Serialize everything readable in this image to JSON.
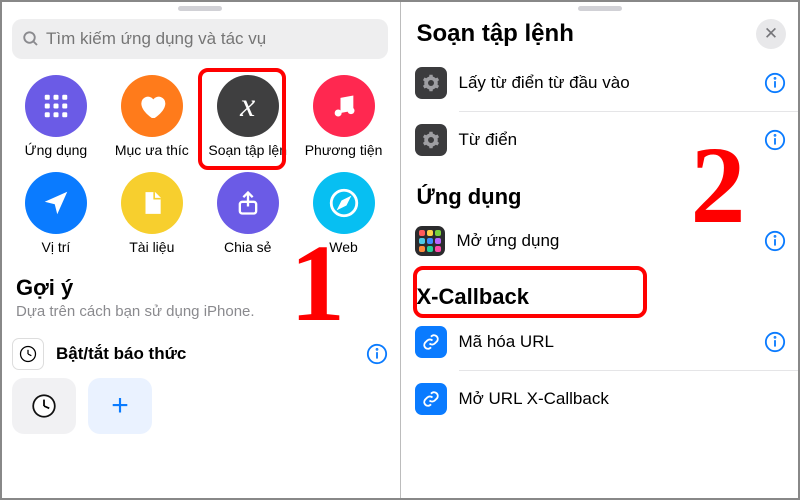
{
  "left": {
    "search_placeholder": "Tìm kiếm ứng dụng và tác vụ",
    "categories": [
      {
        "id": "apps",
        "label": "Ứng dụng",
        "bg": "#6b5be6",
        "icon": "grid"
      },
      {
        "id": "favorites",
        "label": "Mục ưa thíc",
        "bg": "#ff7b1b",
        "icon": "heart"
      },
      {
        "id": "scripting",
        "label": "Soạn tập lện",
        "bg": "#3f3f40",
        "icon": "x-italic"
      },
      {
        "id": "media",
        "label": "Phương tiện",
        "bg": "#ff2850",
        "icon": "music"
      },
      {
        "id": "location",
        "label": "Vị trí",
        "bg": "#0a7bff",
        "icon": "nav"
      },
      {
        "id": "documents",
        "label": "Tài liệu",
        "bg": "#f7cf2e",
        "icon": "doc"
      },
      {
        "id": "sharing",
        "label": "Chia sẻ",
        "bg": "#6b5be6",
        "icon": "share"
      },
      {
        "id": "web",
        "label": "Web",
        "bg": "#07bff2",
        "icon": "safari"
      }
    ],
    "suggestions_title": "Gợi ý",
    "suggestions_sub": "Dựa trên cách bạn sử dụng iPhone.",
    "suggestion_row": {
      "label": "Bật/tắt báo thức"
    }
  },
  "right": {
    "title": "Soạn tập lệnh",
    "top_items": [
      {
        "label": "Lấy từ điển từ đầu vào"
      },
      {
        "label": "Từ điển"
      }
    ],
    "group_apps": {
      "title": "Ứng dụng",
      "items": [
        {
          "id": "open-app",
          "label": "Mở ứng dụng"
        }
      ]
    },
    "group_xcb": {
      "title": "X-Callback",
      "items": [
        {
          "label": "Mã hóa URL"
        },
        {
          "label": "Mở URL X-Callback"
        }
      ]
    }
  },
  "annotations": {
    "step1": "1",
    "step2": "2"
  },
  "shortcuts_icon_colors": [
    "#ff5a5a",
    "#ffd24a",
    "#7bd13c",
    "#4ecbe6",
    "#3b8dff",
    "#b964ff",
    "#ff8a3b",
    "#22d39b",
    "#ff4aa8"
  ]
}
